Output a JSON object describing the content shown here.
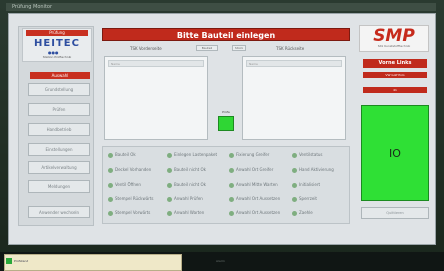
{
  "window": {
    "title": "Prüfung Monitor"
  },
  "logo": {
    "badge": "Prüfung",
    "name": "HEITEC",
    "subtitle": "Station Prüftechnik"
  },
  "left_menu": {
    "heading": "Auswahl",
    "items": [
      "Grundstellung",
      "Prüfen",
      "Handbetrieb",
      "Einstellungen",
      "Artikelverwaltung",
      "Meldungen"
    ],
    "bottom_button": "Anwender wechseln"
  },
  "main": {
    "title": "Bitte Bauteil einlegen",
    "left_list_header": "TSK Vorderseite",
    "right_list_header": "TSK Rückseite",
    "tabs": [
      "Bauteil",
      "Stück"
    ],
    "left_list_field": "Name",
    "right_list_field": "Name",
    "check_label": "Prüfe"
  },
  "checks": [
    [
      "Bauteil Ok",
      "Einlegen Lastenpaket",
      "Fixierung Greifer",
      "Ventilstatus"
    ],
    [
      "Deckel Vorhanden",
      "Bauteil nicht Ok",
      "Anwahl Ort Greifer",
      "Hand Aktivierung"
    ],
    [
      "Ventil Öffnen",
      "Bauteil nicht Ok",
      "Anwahl Mitte Warten",
      "Initialisiert"
    ],
    [
      "Stempel Rückwärts",
      "Anwahl Prüfen",
      "Anwahl Ort Aussetzen",
      "Sperrzeit"
    ],
    [
      "Stempel Vorwärts",
      "Anwahl Warten",
      "Anwahl Ort Aussetzen",
      "Zaehle"
    ]
  ],
  "right_panel": {
    "brand": "SMP",
    "brand_sub": "Sitz Kunststofftechnik",
    "position": "Vorne Links",
    "info_1": "VW Golf Polo",
    "info_2": "41",
    "status": "IO",
    "bottom_button": "Quittieren"
  },
  "taskbar": {
    "item": "Prüfstand",
    "right_text": "Alarm"
  },
  "colors": {
    "accent_red": "#c02a1c",
    "status_green": "#2fe035"
  }
}
